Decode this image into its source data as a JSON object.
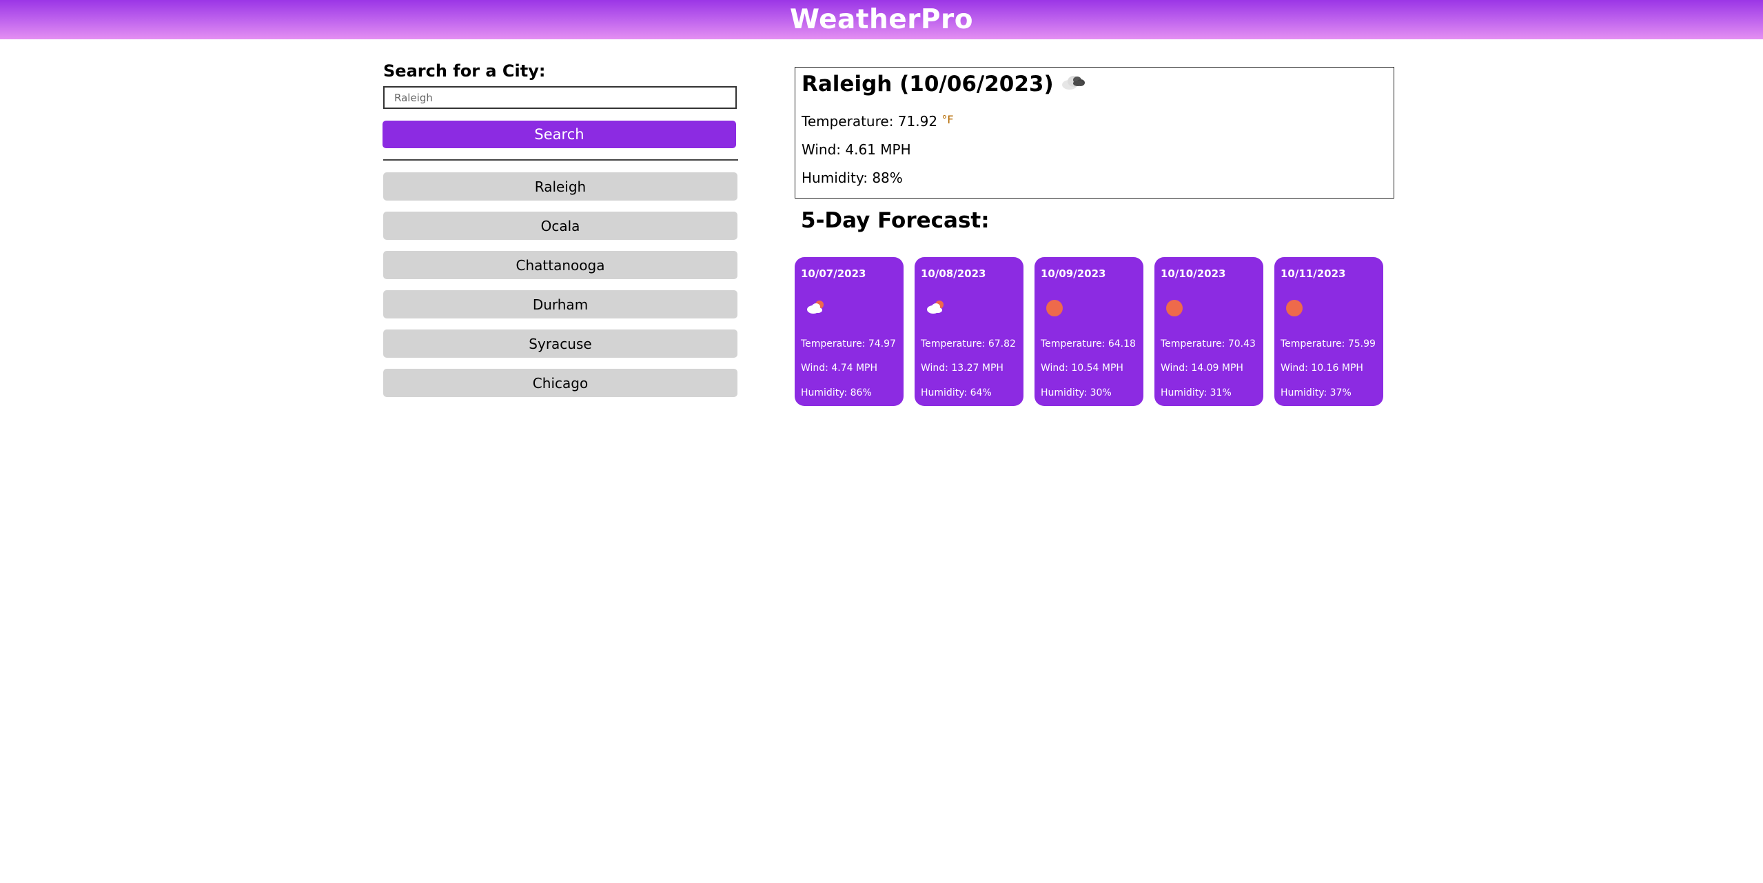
{
  "app": {
    "title": "WeatherPro"
  },
  "search": {
    "label": "Search for a City:",
    "placeholder": "Raleigh",
    "button_label": "Search"
  },
  "history": [
    "Raleigh",
    "Ocala",
    "Chattanooga",
    "Durham",
    "Syracuse",
    "Chicago"
  ],
  "current": {
    "title": "Raleigh (10/06/2023)",
    "icon": "cloudy-icon",
    "temperature_label": "Temperature: ",
    "temperature_value": "71.92",
    "temperature_unit": "°F",
    "wind": "Wind: 4.61 MPH",
    "humidity": "Humidity: 88%"
  },
  "forecast": {
    "title": "5-Day Forecast:",
    "days": [
      {
        "date": "10/07/2023",
        "icon": "partly-cloudy-icon",
        "temperature": "Temperature: 74.97",
        "wind": "Wind: 4.74 MPH",
        "humidity": "Humidity: 86%"
      },
      {
        "date": "10/08/2023",
        "icon": "partly-cloudy-icon",
        "temperature": "Temperature: 67.82",
        "wind": "Wind: 13.27 MPH",
        "humidity": "Humidity: 64%"
      },
      {
        "date": "10/09/2023",
        "icon": "sun-icon",
        "temperature": "Temperature: 64.18",
        "wind": "Wind: 10.54 MPH",
        "humidity": "Humidity: 30%"
      },
      {
        "date": "10/10/2023",
        "icon": "sun-icon",
        "temperature": "Temperature: 70.43",
        "wind": "Wind: 14.09 MPH",
        "humidity": "Humidity: 31%"
      },
      {
        "date": "10/11/2023",
        "icon": "sun-icon",
        "temperature": "Temperature: 75.99",
        "wind": "Wind: 10.16 MPH",
        "humidity": "Humidity: 37%"
      }
    ]
  },
  "colors": {
    "accent": "#8c2be2",
    "history_button": "#d3d3d3",
    "sun": "#ee6a4b"
  }
}
